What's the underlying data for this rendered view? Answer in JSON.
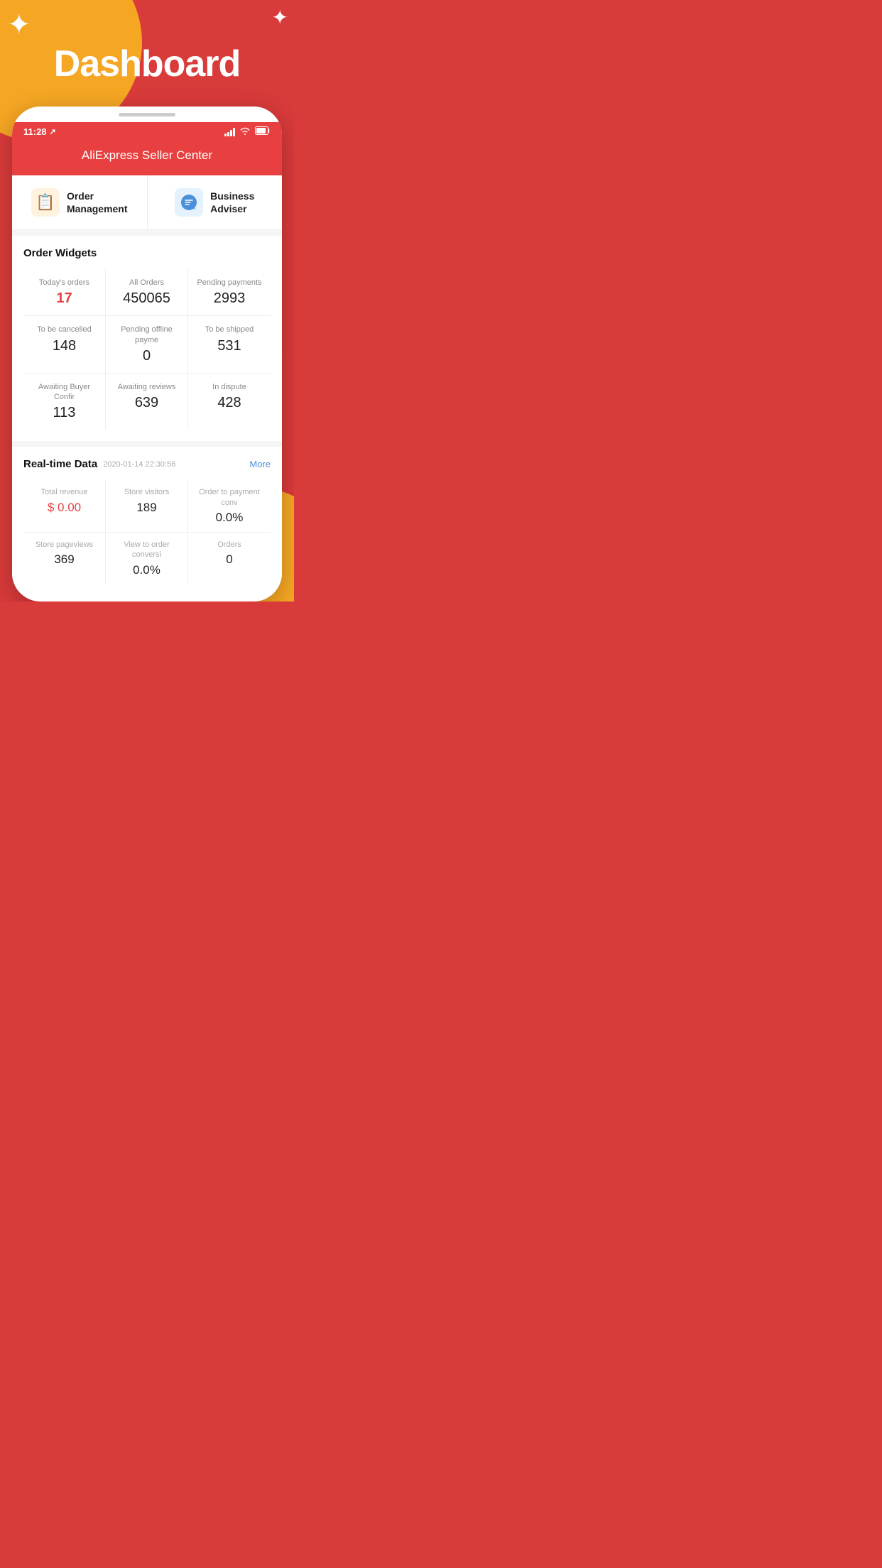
{
  "background": {
    "color": "#d93a3a"
  },
  "header": {
    "title": "Dashboard"
  },
  "status_bar": {
    "time": "11:28",
    "location_arrow": "⟩",
    "battery": "▮▮▮",
    "wifi": "wifi",
    "signal": "signal"
  },
  "app_title": "AliExpress Seller Center",
  "quick_actions": [
    {
      "id": "order-management",
      "icon": "📋",
      "icon_bg": "order",
      "label": "Order\nManagement"
    },
    {
      "id": "business-adviser",
      "icon": "💬",
      "icon_bg": "business",
      "label": "Business\nAdviser"
    }
  ],
  "order_widgets": {
    "section_title": "Order Widgets",
    "items": [
      {
        "label": "Today's orders",
        "value": "17",
        "highlight": true
      },
      {
        "label": "All Orders",
        "value": "450065",
        "highlight": false
      },
      {
        "label": "Pending payments",
        "value": "2993",
        "highlight": false
      },
      {
        "label": "To be cancelled",
        "value": "148",
        "highlight": false
      },
      {
        "label": "Pending offline payme",
        "value": "0",
        "highlight": false
      },
      {
        "label": "To be shipped",
        "value": "531",
        "highlight": false
      },
      {
        "label": "Awaiting Buyer Confir",
        "value": "113",
        "highlight": false
      },
      {
        "label": "Awaiting reviews",
        "value": "639",
        "highlight": false
      },
      {
        "label": "In dispute",
        "value": "428",
        "highlight": false
      }
    ]
  },
  "realtime_data": {
    "section_title": "Real-time Data",
    "timestamp": "2020-01-14 22:30:56",
    "more_label": "More",
    "items": [
      {
        "label": "Total revenue",
        "value": "$ 0.00",
        "highlight": true
      },
      {
        "label": "Store visitors",
        "value": "189",
        "highlight": false
      },
      {
        "label": "Order to payment conv",
        "value": "0.0%",
        "highlight": false
      },
      {
        "label": "Store pageviews",
        "value": "369",
        "highlight": false
      },
      {
        "label": "View to order conversi",
        "value": "0.0%",
        "highlight": false
      },
      {
        "label": "Orders",
        "value": "0",
        "highlight": false
      }
    ]
  }
}
